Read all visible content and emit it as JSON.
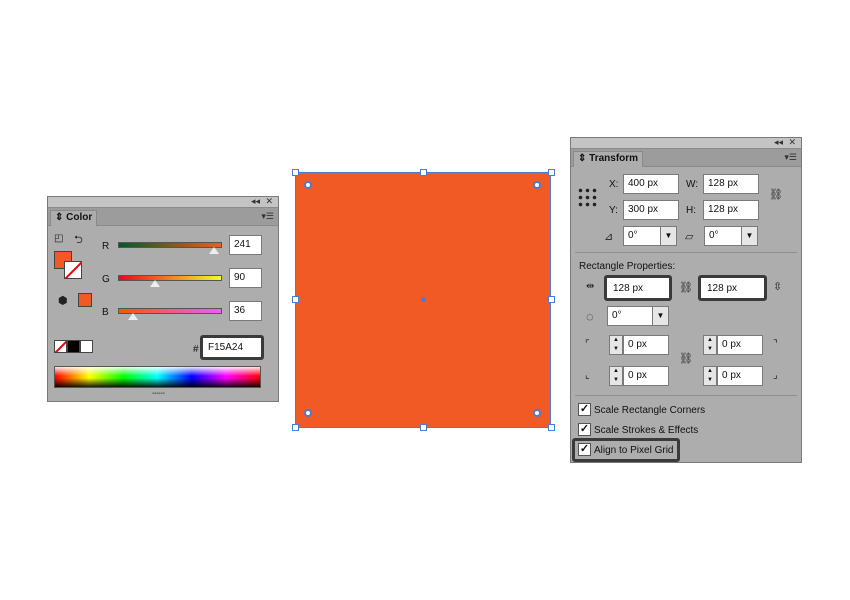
{
  "color_panel": {
    "tab_label": "Color",
    "fill_color": "#F15A24",
    "channels": [
      {
        "label": "R",
        "value": "241",
        "fraction": 0.945
      },
      {
        "label": "G",
        "value": "90",
        "fraction": 0.353
      },
      {
        "label": "B",
        "value": "36",
        "fraction": 0.141
      }
    ],
    "hex_label": "#",
    "hex_value": "F15A24"
  },
  "canvas": {
    "rect_color": "#F15A24",
    "selection_color": "#4A7BD5"
  },
  "transform_panel": {
    "tab_label": "Transform",
    "x_label": "X:",
    "x_value": "400 px",
    "y_label": "Y:",
    "y_value": "300 px",
    "w_label": "W:",
    "w_value": "128 px",
    "h_label": "H:",
    "h_value": "128 px",
    "angle_value": "0°",
    "shear_value": "0°",
    "rect_props_label": "Rectangle Properties:",
    "rect_width": "128 px",
    "rect_height": "128 px",
    "rect_angle": "0°",
    "corner_tl": "0 px",
    "corner_tr": "0 px",
    "corner_bl": "0 px",
    "corner_br": "0 px",
    "options": [
      {
        "label": "Scale Rectangle Corners",
        "checked": true
      },
      {
        "label": "Scale Strokes & Effects",
        "checked": true
      },
      {
        "label": "Align to Pixel Grid",
        "checked": true
      }
    ]
  }
}
